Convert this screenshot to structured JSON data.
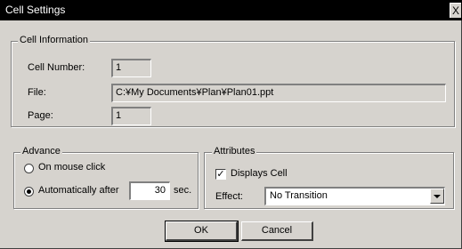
{
  "window": {
    "title": "Cell Settings",
    "close_glyph": "X"
  },
  "cell_info": {
    "legend": "Cell Information",
    "cell_number_label": "Cell Number:",
    "cell_number_value": "1",
    "file_label": "File:",
    "file_value": "C:¥My Documents¥Plan¥Plan01.ppt",
    "page_label": "Page:",
    "page_value": "1"
  },
  "advance": {
    "legend": "Advance",
    "on_mouse_click_label": "On mouse click",
    "on_mouse_click_selected": false,
    "automatically_label": "Automatically after",
    "automatically_selected": true,
    "seconds_value": "30",
    "seconds_unit": "sec."
  },
  "attributes": {
    "legend": "Attributes",
    "displays_cell_label": "Displays Cell",
    "displays_cell_checked": true,
    "effect_label": "Effect:",
    "effect_value": "No Transition"
  },
  "buttons": {
    "ok": "OK",
    "cancel": "Cancel"
  },
  "icons": {
    "close": "close-icon",
    "check": "check-icon",
    "dropdown": "chevron-down-icon"
  }
}
